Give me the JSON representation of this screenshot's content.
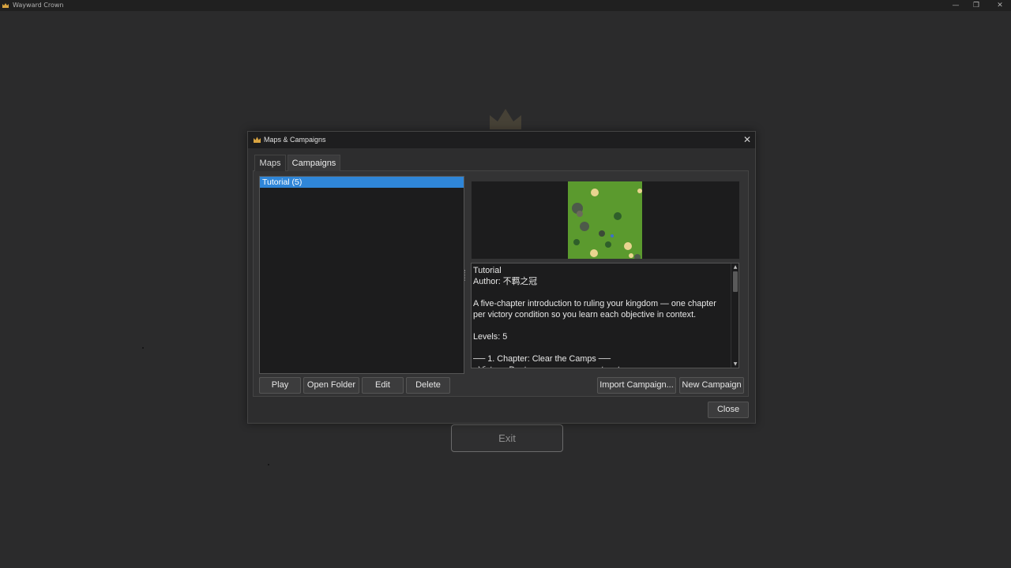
{
  "window": {
    "title": "Wayward Crown",
    "icon": "crown-icon"
  },
  "background": {
    "exit_label": "Exit"
  },
  "dialog": {
    "title": "Maps & Campaigns",
    "icon": "crown-icon",
    "close_glyph": "✕",
    "tabs": [
      {
        "label": "Maps",
        "selected": false
      },
      {
        "label": "Campaigns",
        "selected": true
      }
    ],
    "campaign_list": {
      "items": [
        {
          "label": "Tutorial  (5)",
          "selected": true
        }
      ]
    },
    "details": {
      "text": "Tutorial\nAuthor: 不羁之冠\n\nA five-chapter introduction to ruling your kingdom — one chapter per victory condition so you learn each objective in context.\n\nLevels: 5\n\n── 1. Chapter: Clear the Camps ──\n· Victory: Destroy every enemy outpost"
    },
    "buttons": {
      "play": "Play",
      "open_folder": "Open Folder",
      "edit": "Edit",
      "delete": "Delete",
      "import": "Import Campaign...",
      "new": "New Campaign",
      "close": "Close"
    },
    "colors": {
      "selection": "#2f86d8",
      "map_grass": "#5b9a2e"
    }
  }
}
